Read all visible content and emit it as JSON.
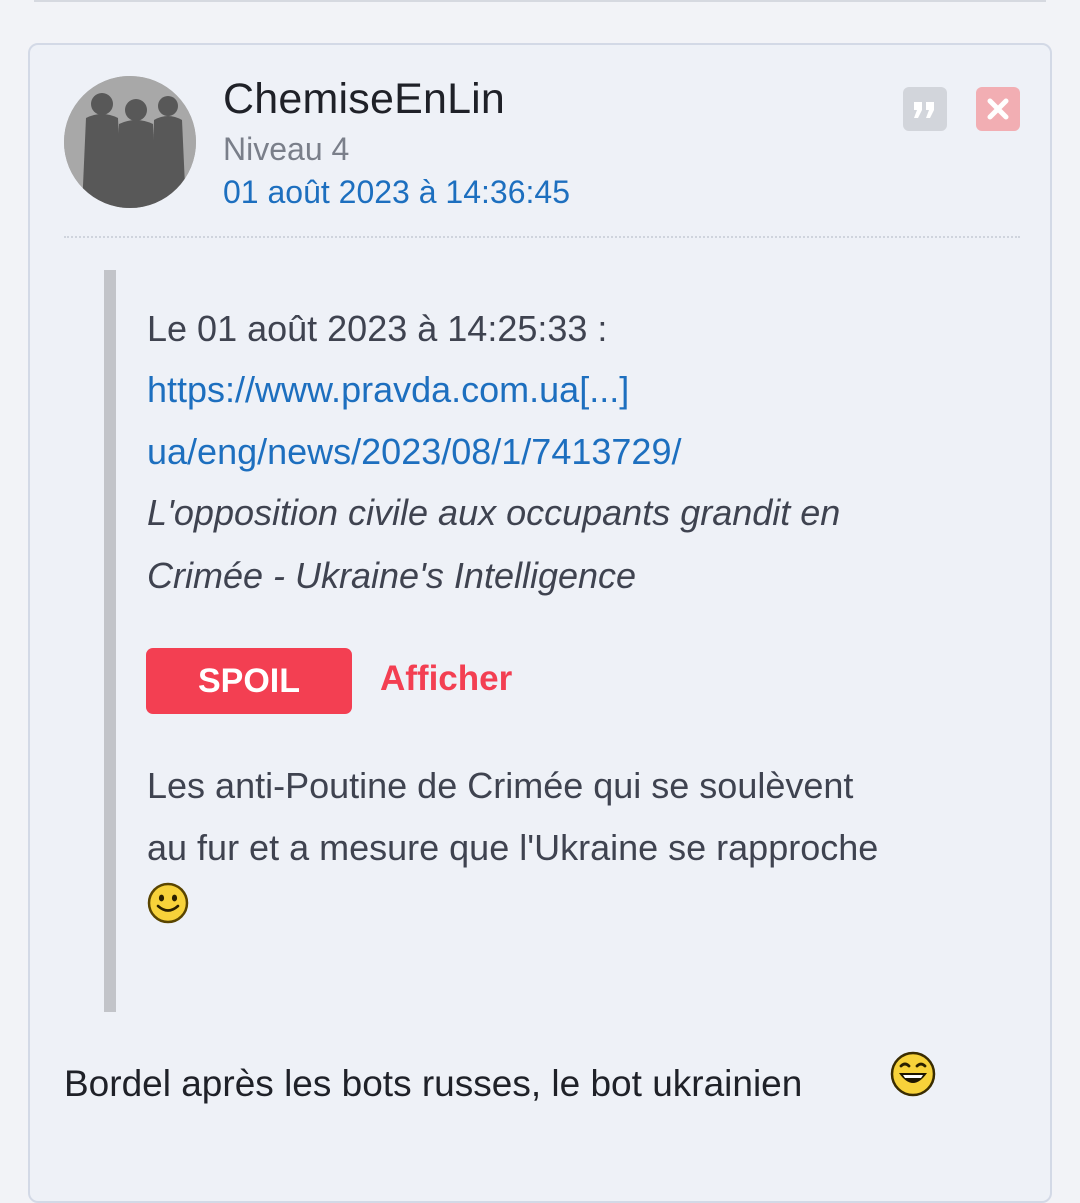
{
  "post": {
    "author": "ChemiseEnLin",
    "level": "Niveau 4",
    "date": "01 août 2023 à 14:36:45",
    "buttons": {
      "quote_icon": "quote-icon",
      "delete_icon": "close-icon"
    },
    "quote": {
      "header": "Le 01 août 2023 à 14:25:33 :",
      "link_line1": "https://www.pravda.com.ua[...]",
      "link_line2": "ua/eng/news/2023/08/1/7413729/",
      "title_line1": "L'opposition civile aux occupants grandit en",
      "title_line2": "Crimée - Ukraine's Intelligence",
      "spoil_label": "SPOIL",
      "spoil_action": "Afficher",
      "body_line1": "Les anti-Poutine de Crimée qui se soulèvent",
      "body_line2": "au fur et a mesure que l'Ukraine se rapproche",
      "smiley": "smile-smiley"
    },
    "reply": {
      "text": "Bordel après les bots russes, le bot ukrainien",
      "smiley": "laugh-smiley"
    }
  },
  "colors": {
    "link": "#1d6fbf",
    "spoil": "#f33f52",
    "text": "#1f2128",
    "muted": "#7a7f8a"
  }
}
